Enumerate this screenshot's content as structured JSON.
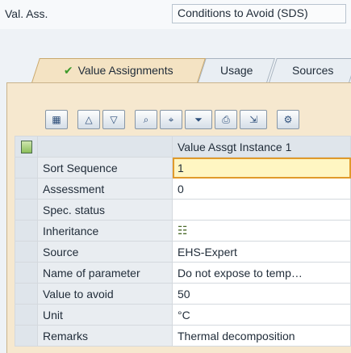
{
  "header": {
    "label": "Val. Ass.",
    "field_value": "Conditions to Avoid (SDS)"
  },
  "tabs": [
    {
      "label": "Value Assignments",
      "active": true
    },
    {
      "label": "Usage"
    },
    {
      "label": "Sources"
    }
  ],
  "grid": {
    "column_header": "Value Assgt Instance 1",
    "rows": [
      {
        "name": "Sort Sequence",
        "value": "1"
      },
      {
        "name": "Assessment",
        "value": "0"
      },
      {
        "name": "Spec. status",
        "value": ""
      },
      {
        "name": "Inheritance",
        "value": "",
        "icon": "hierarchy-icon"
      },
      {
        "name": "Source",
        "value": "EHS-Expert"
      },
      {
        "name": "Name of parameter",
        "value": "Do not expose to temp…"
      },
      {
        "name": "Value to avoid",
        "value": "50"
      },
      {
        "name": "Unit",
        "value": "°C"
      },
      {
        "name": "Remarks",
        "value": "Thermal decomposition"
      }
    ]
  }
}
